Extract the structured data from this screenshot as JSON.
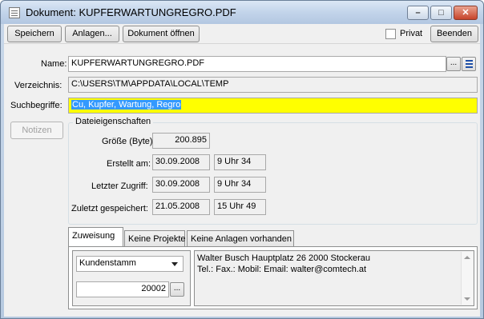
{
  "window": {
    "title": "Dokument: KUPFERWARTUNGREGRO.PDF",
    "controls": {
      "minimize": "–",
      "maximize": "□",
      "close": "✕"
    }
  },
  "toolbar": {
    "save_label": "Speichern",
    "attachments_label": "Anlagen...",
    "open_document_label": "Dokument öffnen",
    "private_label": "Privat",
    "private_checked": false,
    "exit_label": "Beenden"
  },
  "form": {
    "name_label": "Name:",
    "name_value": "KUPFERWARTUNGREGRO.PDF",
    "browse_label": "...",
    "directory_label": "Verzeichnis:",
    "directory_value": "C:\\USERS\\TM\\APPDATA\\LOCAL\\TEMP",
    "keywords_label": "Suchbegriffe:",
    "keywords_value": "Cu, Kupfer, Wartung, Regro",
    "notes_label": "Notizen"
  },
  "file_properties": {
    "group_title": "Dateieigenschaften",
    "size_label": "Größe (Byte):",
    "size_value": "200.895",
    "created_label": "Erstellt am:",
    "created_date": "30.09.2008",
    "created_time": "9 Uhr 34",
    "accessed_label": "Letzter Zugriff:",
    "accessed_date": "30.09.2008",
    "accessed_time": "9 Uhr 34",
    "saved_label": "Zuletzt gespeichert:",
    "saved_date": "21.05.2008",
    "saved_time": "15 Uhr 49"
  },
  "tabs": [
    {
      "label": "Zuweisung",
      "active": true
    },
    {
      "label": "Keine Projekte",
      "active": false
    },
    {
      "label": "Keine Anlagen vorhanden",
      "active": false
    }
  ],
  "assignment": {
    "category_value": "Kundenstamm",
    "number_value": "20002",
    "number_button": "...",
    "contact_line1": "Walter Busch   Hauptplatz 26 2000  Stockerau",
    "contact_line2": "Tel.:  Fax.:  Mobil:  Email: walter@comtech.at"
  },
  "colors": {
    "keywords_background": "#ffff00",
    "selection": "#3399ff",
    "titlebar": "#c2d4ea",
    "close_button": "#c7432a"
  }
}
